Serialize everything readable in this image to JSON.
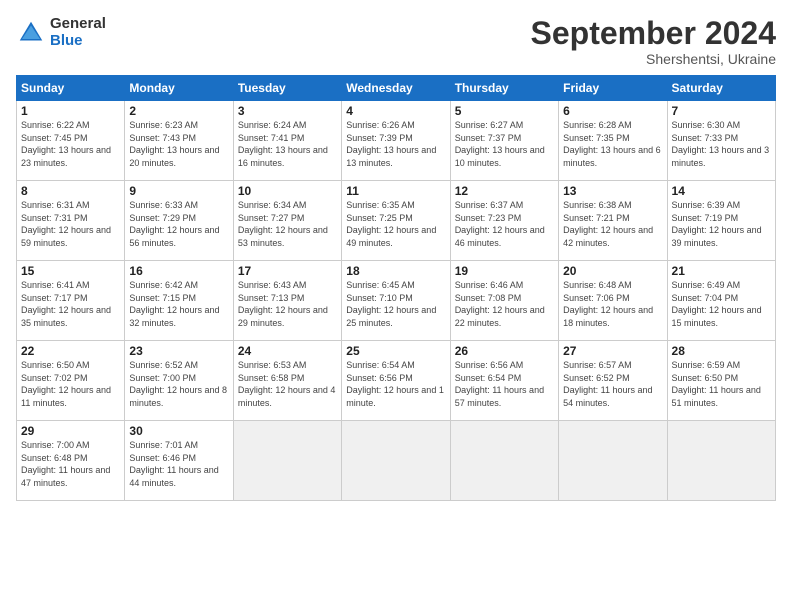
{
  "header": {
    "logo": {
      "general": "General",
      "blue": "Blue"
    },
    "title": "September 2024",
    "subtitle": "Shershentsi, Ukraine"
  },
  "calendar": {
    "weekdays": [
      "Sunday",
      "Monday",
      "Tuesday",
      "Wednesday",
      "Thursday",
      "Friday",
      "Saturday"
    ],
    "weeks": [
      [
        null,
        {
          "day": 2,
          "sunrise": "6:23 AM",
          "sunset": "7:43 PM",
          "daylight": "13 hours and 20 minutes."
        },
        {
          "day": 3,
          "sunrise": "6:24 AM",
          "sunset": "7:41 PM",
          "daylight": "13 hours and 16 minutes."
        },
        {
          "day": 4,
          "sunrise": "6:26 AM",
          "sunset": "7:39 PM",
          "daylight": "13 hours and 13 minutes."
        },
        {
          "day": 5,
          "sunrise": "6:27 AM",
          "sunset": "7:37 PM",
          "daylight": "13 hours and 10 minutes."
        },
        {
          "day": 6,
          "sunrise": "6:28 AM",
          "sunset": "7:35 PM",
          "daylight": "13 hours and 6 minutes."
        },
        {
          "day": 7,
          "sunrise": "6:30 AM",
          "sunset": "7:33 PM",
          "daylight": "13 hours and 3 minutes."
        }
      ],
      [
        {
          "day": 8,
          "sunrise": "6:31 AM",
          "sunset": "7:31 PM",
          "daylight": "12 hours and 59 minutes."
        },
        {
          "day": 9,
          "sunrise": "6:33 AM",
          "sunset": "7:29 PM",
          "daylight": "12 hours and 56 minutes."
        },
        {
          "day": 10,
          "sunrise": "6:34 AM",
          "sunset": "7:27 PM",
          "daylight": "12 hours and 53 minutes."
        },
        {
          "day": 11,
          "sunrise": "6:35 AM",
          "sunset": "7:25 PM",
          "daylight": "12 hours and 49 minutes."
        },
        {
          "day": 12,
          "sunrise": "6:37 AM",
          "sunset": "7:23 PM",
          "daylight": "12 hours and 46 minutes."
        },
        {
          "day": 13,
          "sunrise": "6:38 AM",
          "sunset": "7:21 PM",
          "daylight": "12 hours and 42 minutes."
        },
        {
          "day": 14,
          "sunrise": "6:39 AM",
          "sunset": "7:19 PM",
          "daylight": "12 hours and 39 minutes."
        }
      ],
      [
        {
          "day": 15,
          "sunrise": "6:41 AM",
          "sunset": "7:17 PM",
          "daylight": "12 hours and 35 minutes."
        },
        {
          "day": 16,
          "sunrise": "6:42 AM",
          "sunset": "7:15 PM",
          "daylight": "12 hours and 32 minutes."
        },
        {
          "day": 17,
          "sunrise": "6:43 AM",
          "sunset": "7:13 PM",
          "daylight": "12 hours and 29 minutes."
        },
        {
          "day": 18,
          "sunrise": "6:45 AM",
          "sunset": "7:10 PM",
          "daylight": "12 hours and 25 minutes."
        },
        {
          "day": 19,
          "sunrise": "6:46 AM",
          "sunset": "7:08 PM",
          "daylight": "12 hours and 22 minutes."
        },
        {
          "day": 20,
          "sunrise": "6:48 AM",
          "sunset": "7:06 PM",
          "daylight": "12 hours and 18 minutes."
        },
        {
          "day": 21,
          "sunrise": "6:49 AM",
          "sunset": "7:04 PM",
          "daylight": "12 hours and 15 minutes."
        }
      ],
      [
        {
          "day": 22,
          "sunrise": "6:50 AM",
          "sunset": "7:02 PM",
          "daylight": "12 hours and 11 minutes."
        },
        {
          "day": 23,
          "sunrise": "6:52 AM",
          "sunset": "7:00 PM",
          "daylight": "12 hours and 8 minutes."
        },
        {
          "day": 24,
          "sunrise": "6:53 AM",
          "sunset": "6:58 PM",
          "daylight": "12 hours and 4 minutes."
        },
        {
          "day": 25,
          "sunrise": "6:54 AM",
          "sunset": "6:56 PM",
          "daylight": "12 hours and 1 minute."
        },
        {
          "day": 26,
          "sunrise": "6:56 AM",
          "sunset": "6:54 PM",
          "daylight": "11 hours and 57 minutes."
        },
        {
          "day": 27,
          "sunrise": "6:57 AM",
          "sunset": "6:52 PM",
          "daylight": "11 hours and 54 minutes."
        },
        {
          "day": 28,
          "sunrise": "6:59 AM",
          "sunset": "6:50 PM",
          "daylight": "11 hours and 51 minutes."
        }
      ],
      [
        {
          "day": 29,
          "sunrise": "7:00 AM",
          "sunset": "6:48 PM",
          "daylight": "11 hours and 47 minutes."
        },
        {
          "day": 30,
          "sunrise": "7:01 AM",
          "sunset": "6:46 PM",
          "daylight": "11 hours and 44 minutes."
        },
        null,
        null,
        null,
        null,
        null
      ]
    ],
    "week0_day1": {
      "day": 1,
      "sunrise": "6:22 AM",
      "sunset": "7:45 PM",
      "daylight": "13 hours and 23 minutes."
    }
  }
}
